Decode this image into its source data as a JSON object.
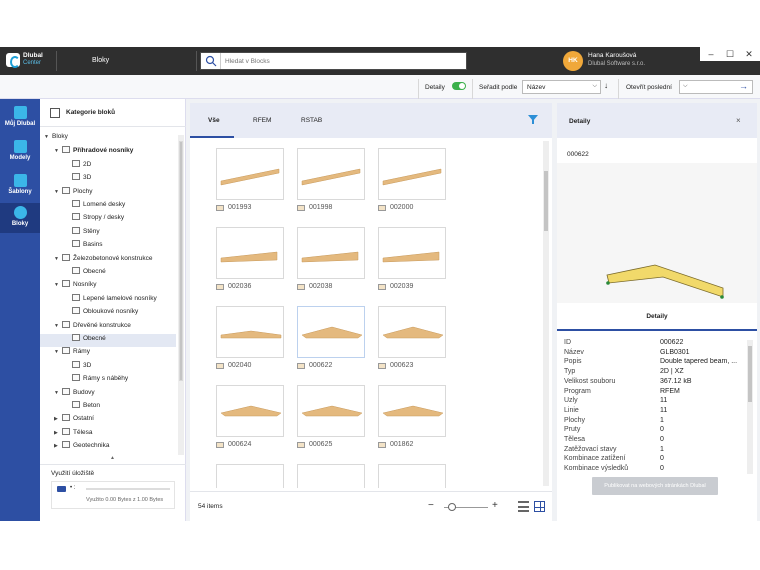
{
  "app": {
    "logo_name": "Dlubal",
    "logo_sub": "Center",
    "breadcrumb": "Bloky"
  },
  "search": {
    "placeholder": "Hledat v Blocks"
  },
  "user": {
    "initials": "HK",
    "name": "Hana Karoušová",
    "org": "Dlubal Software s.r.o."
  },
  "window": {
    "minimize": "–",
    "maximize": "☐",
    "close": "✕"
  },
  "toolbar": {
    "details_label": "Detaily",
    "details_on": true,
    "sort_label": "Seřadit podle",
    "sort_value": "Název",
    "open_recent_label": "Otevřít poslední",
    "open_recent_value": ""
  },
  "leftnav": [
    {
      "label": "Můj Dlubal"
    },
    {
      "label": "Modely"
    },
    {
      "label": "Šablony"
    },
    {
      "label": "Bloky",
      "active": true
    }
  ],
  "categories": {
    "title": "Kategorie bloků",
    "tree": [
      {
        "label": "Bloky",
        "level": 0,
        "expanded": true,
        "folder": false
      },
      {
        "label": "Příhradové nosníky",
        "level": 1,
        "expanded": true,
        "bold": true
      },
      {
        "label": "2D",
        "level": 2
      },
      {
        "label": "3D",
        "level": 2
      },
      {
        "label": "Plochy",
        "level": 1,
        "expanded": true
      },
      {
        "label": "Lomené desky",
        "level": 2
      },
      {
        "label": "Stropy / desky",
        "level": 2
      },
      {
        "label": "Stěny",
        "level": 2
      },
      {
        "label": "Basins",
        "level": 2
      },
      {
        "label": "Železobetonové konstrukce",
        "level": 1,
        "expanded": true
      },
      {
        "label": "Obecné",
        "level": 2
      },
      {
        "label": "Nosníky",
        "level": 1,
        "expanded": true
      },
      {
        "label": "Lepené lamelové nosníky",
        "level": 2
      },
      {
        "label": "Obloukové nosníky",
        "level": 2
      },
      {
        "label": "Dřevěné konstrukce",
        "level": 1,
        "expanded": true
      },
      {
        "label": "Obecné",
        "level": 2,
        "selected": true
      },
      {
        "label": "Rámy",
        "level": 1,
        "expanded": true
      },
      {
        "label": "3D",
        "level": 2
      },
      {
        "label": "Rámy s náběhy",
        "level": 2
      },
      {
        "label": "Budovy",
        "level": 1,
        "expanded": true
      },
      {
        "label": "Beton",
        "level": 2
      },
      {
        "label": "Ostatní",
        "level": 1,
        "expanded": false
      },
      {
        "label": "Tělesa",
        "level": 1,
        "expanded": false
      },
      {
        "label": "Geotechnika",
        "level": 1,
        "expanded": false
      }
    ],
    "storage_title": "Využití úložiště",
    "storage_dots": "• :",
    "storage_usage": "Využito 0.00 Bytes z 1.00 Bytes",
    "storage_fraction": 0
  },
  "main": {
    "tabs": [
      "Vše",
      "RFEM",
      "RSTAB"
    ],
    "active_tab": 0,
    "items": [
      {
        "id": "001993",
        "shape": "slope"
      },
      {
        "id": "001998",
        "shape": "slope"
      },
      {
        "id": "002000",
        "shape": "slope"
      },
      {
        "id": "002036",
        "shape": "slope-flat"
      },
      {
        "id": "002038",
        "shape": "slope-flat"
      },
      {
        "id": "002039",
        "shape": "slope-flat"
      },
      {
        "id": "002040",
        "shape": "ridge-low"
      },
      {
        "id": "000622",
        "shape": "ridge",
        "highlight": true
      },
      {
        "id": "000623",
        "shape": "ridge"
      },
      {
        "id": "000624",
        "shape": "ridge-mid"
      },
      {
        "id": "000625",
        "shape": "ridge-mid"
      },
      {
        "id": "001862",
        "shape": "ridge-mid"
      }
    ],
    "count_label": "54 items",
    "zoom_minus": "−",
    "zoom_plus": "+",
    "zoom_fraction": 0.1
  },
  "detail": {
    "title": "Detaily",
    "close": "×",
    "id": "000622",
    "tab": "Detaily",
    "properties": [
      {
        "key": "ID",
        "value": "000622"
      },
      {
        "key": "Název",
        "value": "GLB0301"
      },
      {
        "key": "Popis",
        "value": "Double tapered beam, ..."
      },
      {
        "key": "Typ",
        "value": "2D | XZ"
      },
      {
        "key": "Velikost souboru",
        "value": "367.12 kB"
      },
      {
        "key": "Program",
        "value": "RFEM"
      },
      {
        "key": "Uzly",
        "value": "11"
      },
      {
        "key": "Linie",
        "value": "11"
      },
      {
        "key": "Plochy",
        "value": "1"
      },
      {
        "key": "Pruty",
        "value": "0"
      },
      {
        "key": "Tělesa",
        "value": "0"
      },
      {
        "key": "Zatěžovací stavy",
        "value": "1"
      },
      {
        "key": "Kombinace zatížení",
        "value": "0"
      },
      {
        "key": "Kombinace výsledků",
        "value": "0"
      }
    ],
    "publish_label": "Publikovat na webových stránkách Dlubal"
  },
  "colors": {
    "accent": "#2d4fa3",
    "beam": "#e4b97e",
    "beam_preview": "#f1d96a",
    "toggle": "#3ab04b"
  }
}
